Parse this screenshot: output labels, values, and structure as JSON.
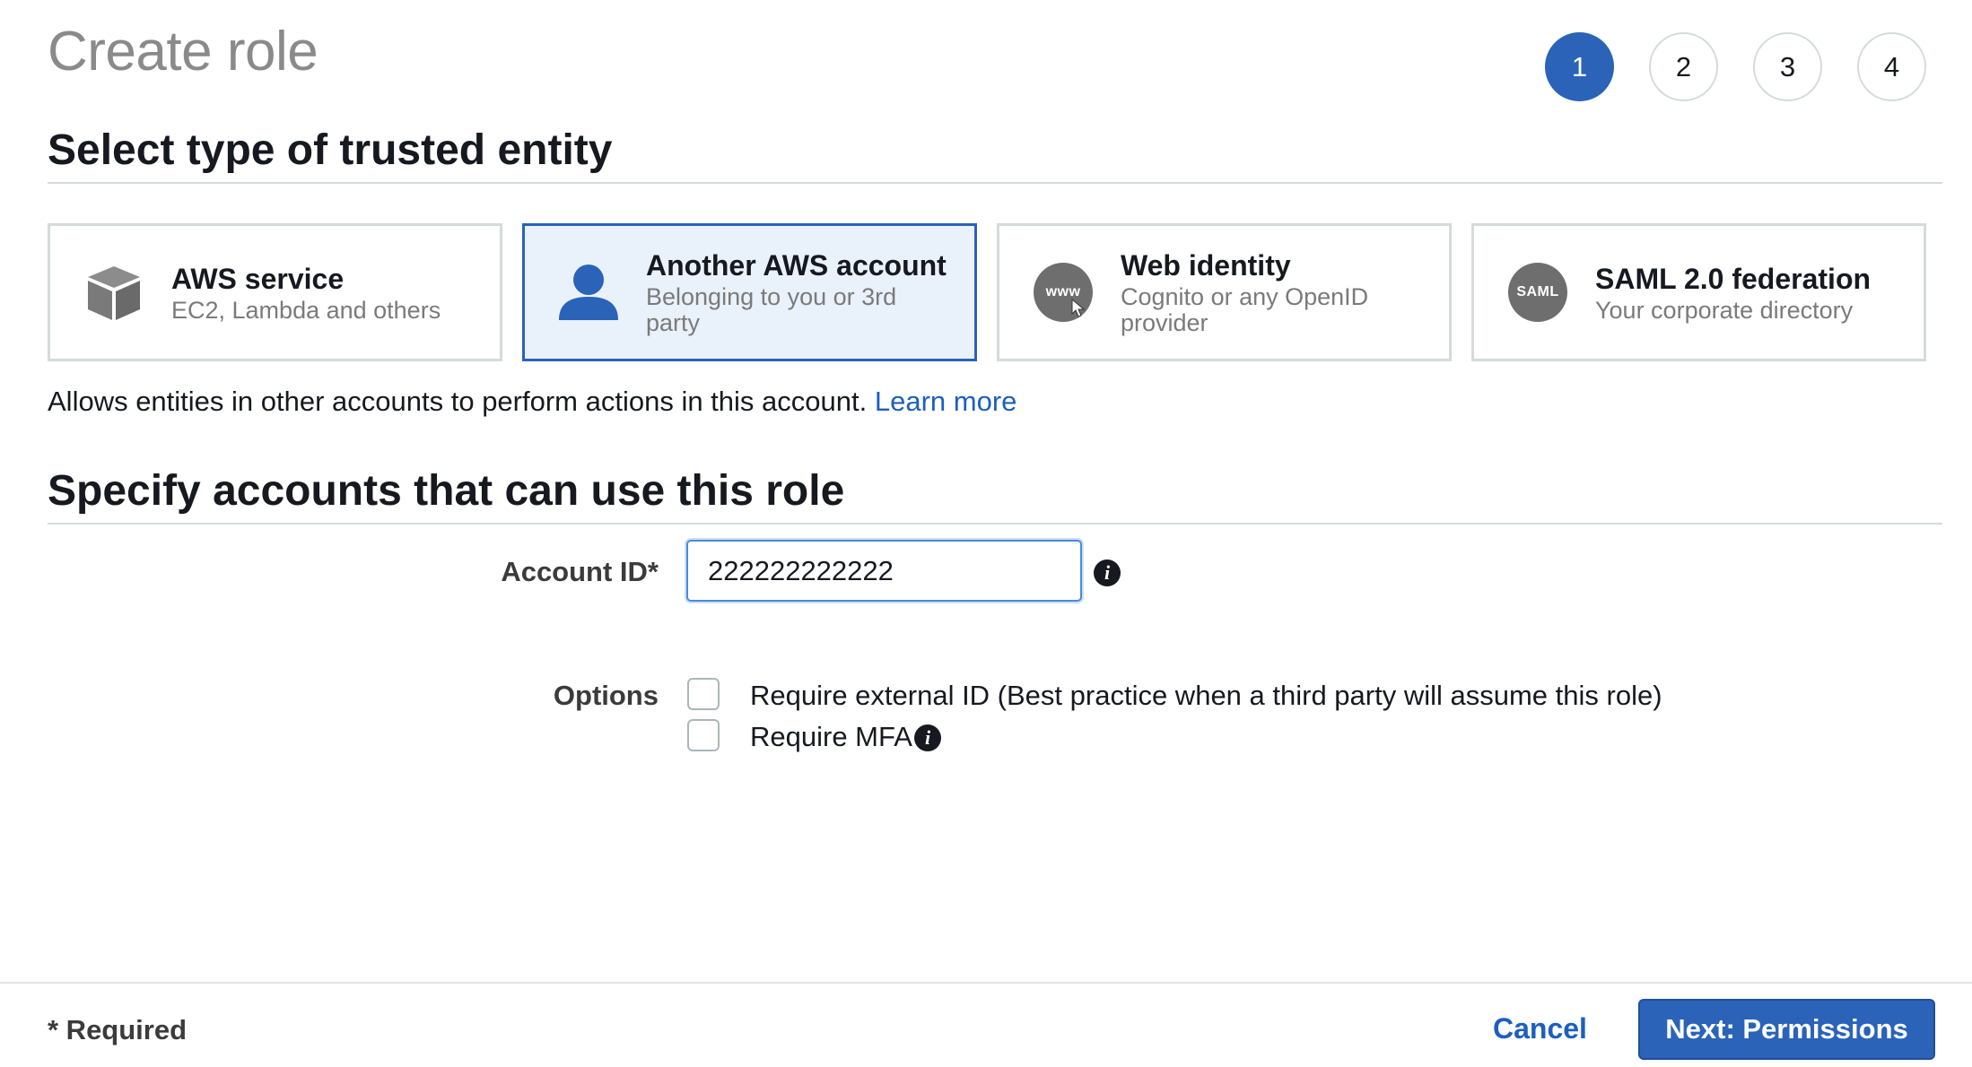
{
  "page": {
    "title": "Create role"
  },
  "steps": [
    "1",
    "2",
    "3",
    "4"
  ],
  "active_step": "1",
  "section1": {
    "title": "Select type of trusted entity"
  },
  "tiles": [
    {
      "title": "AWS service",
      "subtitle": "EC2, Lambda and others",
      "icon": "cube-icon",
      "selected": false
    },
    {
      "title": "Another AWS account",
      "subtitle": "Belonging to you or 3rd party",
      "icon": "user-icon",
      "selected": true
    },
    {
      "title": "Web identity",
      "subtitle": "Cognito or any OpenID provider",
      "icon": "www-icon",
      "icon_text": "www",
      "selected": false
    },
    {
      "title": "SAML 2.0 federation",
      "subtitle": "Your corporate directory",
      "icon": "saml-icon",
      "icon_text": "SAML",
      "selected": false
    }
  ],
  "description": {
    "text": "Allows entities in other accounts to perform actions in this account.",
    "link": "Learn more"
  },
  "section2": {
    "title": "Specify accounts that can use this role"
  },
  "account_id": {
    "label": "Account ID*",
    "value": "222222222222",
    "info_icon": "info-icon"
  },
  "options": {
    "label": "Options",
    "items": [
      {
        "label": "Require external ID (Best practice when a third party will assume this role)",
        "checked": false
      },
      {
        "label": "Require MFA",
        "checked": false,
        "info_icon": "info-icon"
      }
    ]
  },
  "footer": {
    "required_note": "* Required",
    "cancel_label": "Cancel",
    "next_label": "Next: Permissions"
  },
  "colors": {
    "accent": "#2a63b8",
    "link": "#1c5fbf",
    "selected_tile_bg": "#e9f1fb",
    "border": "#d5dbdb"
  }
}
